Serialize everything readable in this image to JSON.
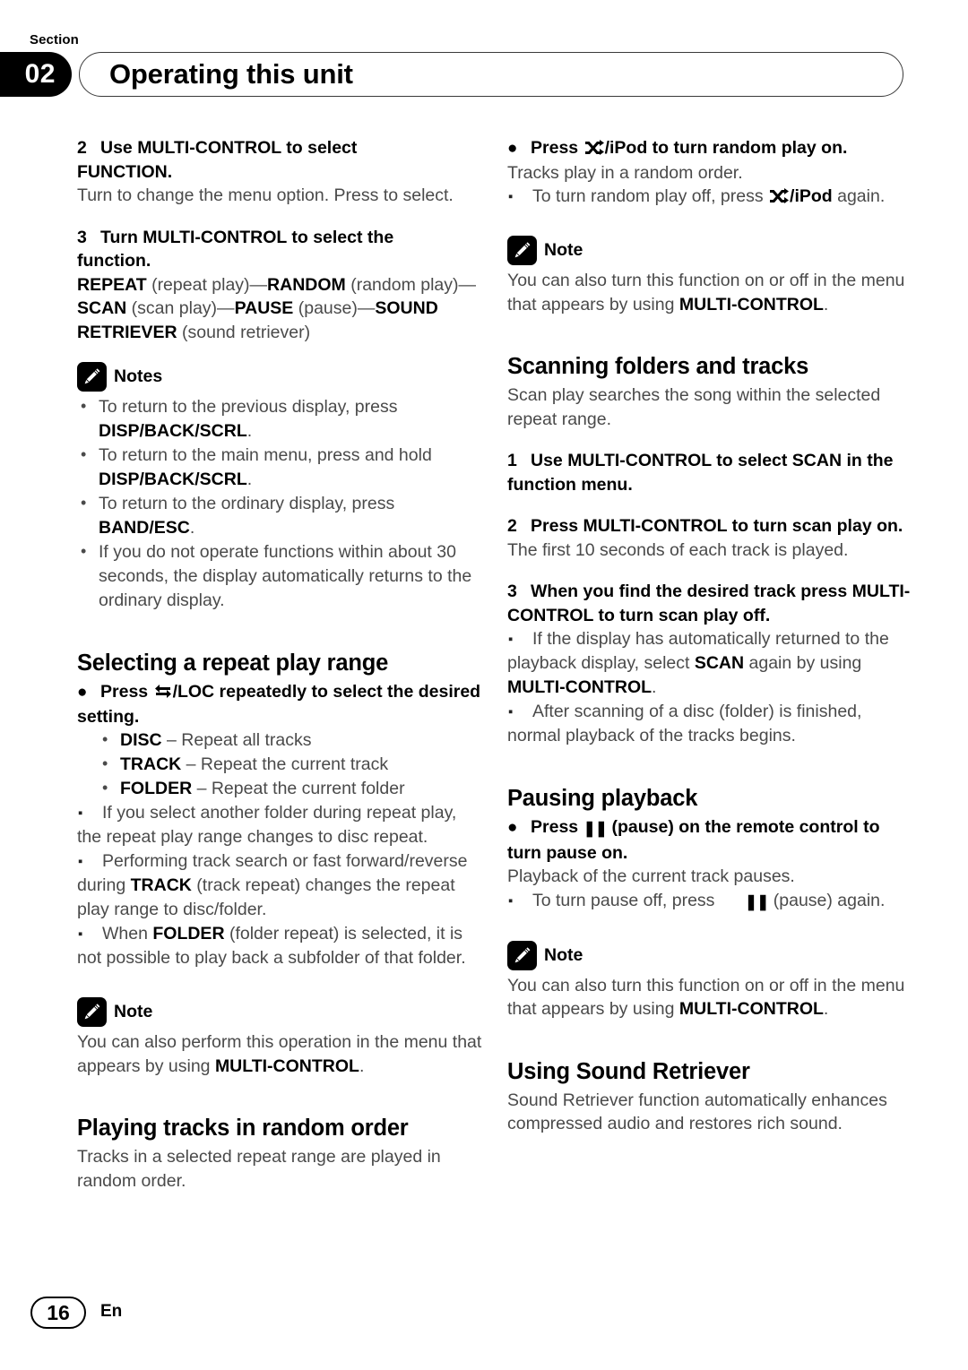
{
  "header": {
    "section_word": "Section",
    "section_number": "02",
    "title": "Operating this unit"
  },
  "footer": {
    "page_number": "16",
    "language_code": "En"
  },
  "icons": {
    "note": "pencil-icon",
    "loc": "two-way-arrow-icon",
    "ipod": "shuffle-icon",
    "pause": "pause-bars-icon"
  },
  "left_column": {
    "step2": {
      "num": "2",
      "title_a": "Use MULTI-CONTROL to select",
      "title_b": "FUNCTION.",
      "body": "Turn to change the menu option. Press to select."
    },
    "step3": {
      "num": "3",
      "title_a": "Turn MULTI-CONTROL to select the",
      "title_b": "function.",
      "chain": [
        {
          "bold": "REPEAT",
          "plain": " (repeat play)—"
        },
        {
          "bold": "RANDOM",
          "plain": " (random play)—"
        },
        {
          "bold": "SCAN",
          "plain": " (scan play)—"
        },
        {
          "bold": "PAUSE",
          "plain": " (pause)—"
        },
        {
          "bold": "SOUND RETRIEVER",
          "plain": " (sound retriever)"
        }
      ]
    },
    "notes_label": "Notes",
    "notes": [
      {
        "pre": "To return to the previous display, press ",
        "bold": "DISP/BACK/SCRL",
        "post": "."
      },
      {
        "pre": "To return to the main menu, press and hold ",
        "bold": "DISP/BACK/SCRL",
        "post": "."
      },
      {
        "pre": "To return to the ordinary display, press ",
        "bold": "BAND/ESC",
        "post": "."
      },
      {
        "pre": "If you do not operate functions within about 30 seconds, the display automatically returns to the ordinary display.",
        "bold": "",
        "post": ""
      }
    ],
    "repeat_section": {
      "heading": "Selecting a repeat play range",
      "instruction_pre": "Press ",
      "instruction_post": "/LOC repeatedly to select the desired setting.",
      "options": [
        {
          "bold": "DISC",
          "plain": " – Repeat all tracks"
        },
        {
          "bold": "TRACK",
          "plain": " – Repeat the current track"
        },
        {
          "bold": "FOLDER",
          "plain": " – Repeat the current folder"
        }
      ],
      "notes": [
        {
          "parts": [
            {
              "t": "If you select another folder during repeat play, the repeat play range changes to disc repeat.",
              "b": false
            }
          ]
        },
        {
          "parts": [
            {
              "t": "Performing track search or fast forward/reverse during ",
              "b": false
            },
            {
              "t": "TRACK",
              "b": true
            },
            {
              "t": " (track repeat) changes the repeat play range to disc/folder.",
              "b": false
            }
          ]
        },
        {
          "parts": [
            {
              "t": "When ",
              "b": false
            },
            {
              "t": "FOLDER",
              "b": true
            },
            {
              "t": " (folder repeat) is selected, it is not possible to play back a subfolder of that folder.",
              "b": false
            }
          ]
        }
      ],
      "note_label": "Note",
      "note_body_pre": "You can also perform this operation in the menu that appears by using ",
      "note_body_bold": "MULTI-CONTROL",
      "note_body_post": "."
    },
    "random_section": {
      "heading": "Playing tracks in random order",
      "body": "Tracks in a selected repeat range are played in random order."
    }
  },
  "right_column": {
    "random_instruction": {
      "pre": "Press ",
      "post": "/iPod to turn random play on.",
      "body": "Tracks play in a random order.",
      "note_pre": "To turn random play off, press ",
      "note_bold": "/iPod",
      "note_post": " again."
    },
    "note_label": "Note",
    "note_body_pre": "You can also turn this function on or off in the menu that appears by using ",
    "note_body_bold": "MULTI-CONTROL",
    "note_body_post": ".",
    "scan_section": {
      "heading": "Scanning folders and tracks",
      "body": "Scan play searches the song within the selected repeat range.",
      "step1": {
        "num": "1",
        "text": "Use MULTI-CONTROL to select SCAN in the function menu."
      },
      "step2": {
        "num": "2",
        "text": "Press MULTI-CONTROL to turn scan play on.",
        "body": "The first 10 seconds of each track is played."
      },
      "step3": {
        "num": "3",
        "text": "When you find the desired track press MULTI-CONTROL to turn scan play off."
      },
      "notes": [
        {
          "parts": [
            {
              "t": "If the display has automatically returned to the playback display, select ",
              "b": false
            },
            {
              "t": "SCAN",
              "b": true
            },
            {
              "t": " again by using ",
              "b": false
            },
            {
              "t": "MULTI-CONTROL",
              "b": true
            },
            {
              "t": ".",
              "b": false
            }
          ]
        },
        {
          "parts": [
            {
              "t": "After scanning of a disc (folder) is finished, normal playback of the tracks begins.",
              "b": false
            }
          ]
        }
      ]
    },
    "pause_section": {
      "heading": "Pausing playback",
      "instruction_pre": "Press ",
      "instruction_post": " (pause) on the remote control to turn pause on.",
      "body": "Playback of the current track pauses.",
      "note_pre": "To turn pause off, press ",
      "note_post": " (pause) again."
    },
    "note2_label": "Note",
    "note2_body_pre": "You can also turn this function on or off in the menu that appears by using ",
    "note2_body_bold": "MULTI-CONTROL",
    "note2_body_post": ".",
    "retriever_section": {
      "heading": "Using Sound Retriever",
      "body": "Sound Retriever function automatically enhances compressed audio and restores rich sound."
    }
  }
}
